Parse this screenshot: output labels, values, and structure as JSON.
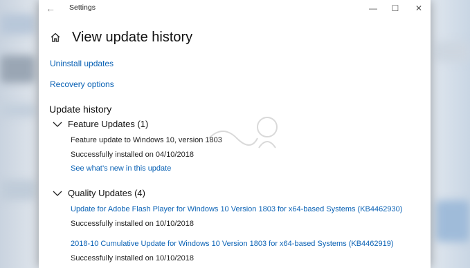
{
  "window": {
    "title": "Settings",
    "back_symbol": "←",
    "minimize_symbol": "—",
    "maximize_symbol": "☐",
    "close_symbol": "✕"
  },
  "page": {
    "title": "View update history",
    "home_icon": "home-icon"
  },
  "links": {
    "uninstall": "Uninstall updates",
    "recovery": "Recovery options"
  },
  "update_history": {
    "title": "Update history",
    "groups": [
      {
        "label": "Feature Updates (1)",
        "items": [
          {
            "name": "Feature update to Windows 10, version 1803",
            "status": "Successfully installed on 04/10/2018",
            "link": "See what’s new in this update"
          }
        ]
      },
      {
        "label": "Quality Updates (4)",
        "items": [
          {
            "name": "Update for Adobe Flash Player for Windows 10 Version 1803 for x64-based Systems (KB4462930)",
            "status": "Successfully installed on 10/10/2018"
          },
          {
            "name": "2018-10 Cumulative Update for Windows 10 Version 1803 for x64-based Systems (KB4462919)",
            "status": "Successfully installed on 10/10/2018"
          }
        ]
      }
    ]
  },
  "colors": {
    "link": "#0a62b5",
    "text": "#222222",
    "window_bg": "#ffffff"
  }
}
